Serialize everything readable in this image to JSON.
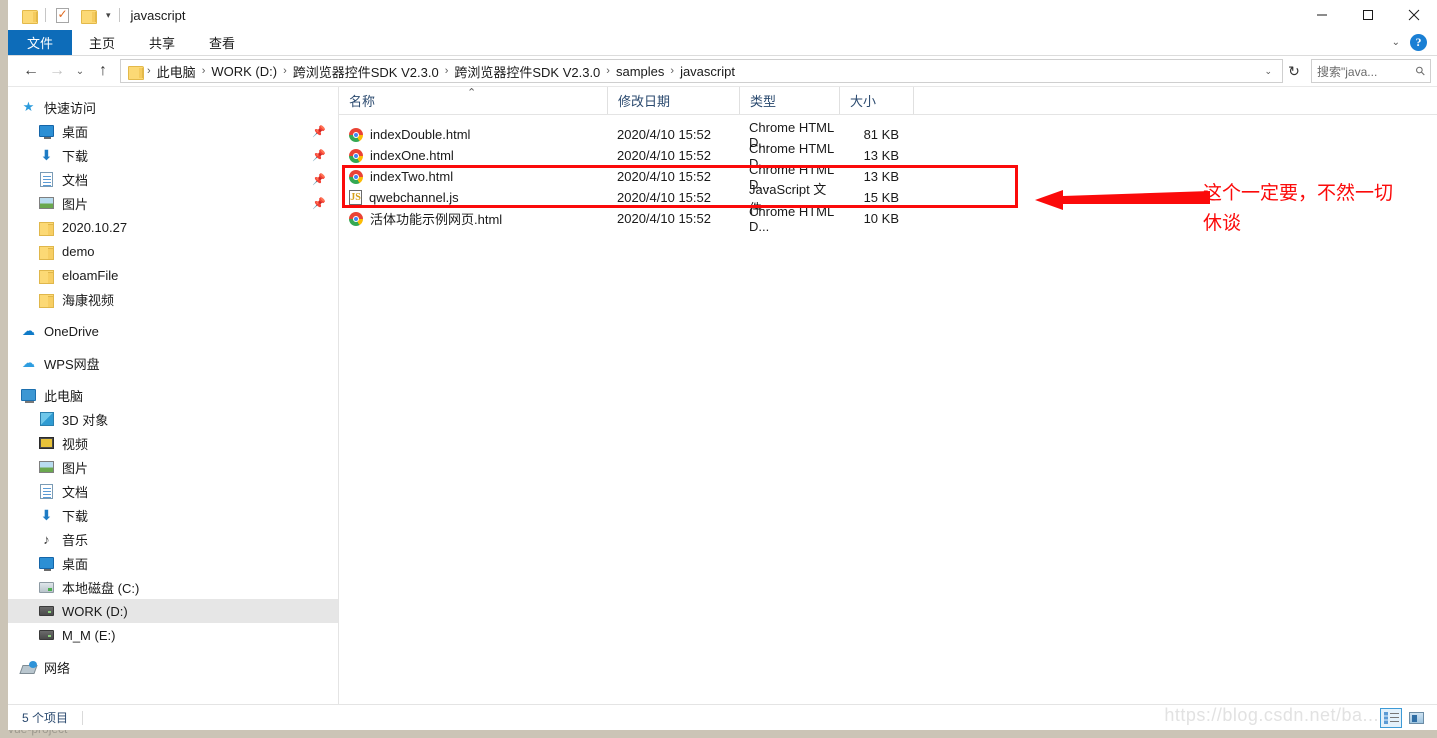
{
  "window": {
    "title": "javascript",
    "controls": {
      "minimize": "minimize-icon",
      "maximize": "maximize-icon",
      "close": "close-icon"
    },
    "quick_access_toolbar": [
      "folder-icon",
      "properties-icon",
      "new-folder-icon",
      "customize-caret-icon"
    ]
  },
  "ribbon": {
    "tabs": [
      {
        "label": "文件",
        "active": true
      },
      {
        "label": "主页",
        "active": false
      },
      {
        "label": "共享",
        "active": false
      },
      {
        "label": "查看",
        "active": false
      }
    ],
    "collapse_caret": "⌄",
    "help_label": "?"
  },
  "nav": {
    "back_icon": "←",
    "forward_icon": "→",
    "recent_icon": "⌄",
    "up_icon": "↑",
    "breadcrumbs": [
      "此电脑",
      "WORK (D:)",
      "跨浏览器控件SDK V2.3.0",
      "跨浏览器控件SDK V2.3.0",
      "samples",
      "javascript"
    ],
    "breadcrumb_separator": "›",
    "dropdown_caret": "⌄",
    "refresh_icon": "↻"
  },
  "search": {
    "placeholder": "搜索\"java...",
    "icon": "search-icon"
  },
  "sidebar": {
    "items": [
      {
        "label": "快速访问",
        "icon": "star-pin-icon",
        "level": 0,
        "pinned": false,
        "selected": false
      },
      {
        "label": "桌面",
        "icon": "desktop-icon",
        "level": 1,
        "pinned": true,
        "selected": false
      },
      {
        "label": "下载",
        "icon": "download-icon",
        "level": 1,
        "pinned": true,
        "selected": false
      },
      {
        "label": "文档",
        "icon": "documents-icon",
        "level": 1,
        "pinned": true,
        "selected": false
      },
      {
        "label": "图片",
        "icon": "pictures-icon",
        "level": 1,
        "pinned": true,
        "selected": false
      },
      {
        "label": "2020.10.27",
        "icon": "folder-icon",
        "level": 1,
        "pinned": false,
        "selected": false
      },
      {
        "label": "demo",
        "icon": "folder-icon",
        "level": 1,
        "pinned": false,
        "selected": false
      },
      {
        "label": "eloamFile",
        "icon": "folder-icon",
        "level": 1,
        "pinned": false,
        "selected": false
      },
      {
        "label": "海康视频",
        "icon": "folder-icon",
        "level": 1,
        "pinned": false,
        "selected": false
      },
      {
        "label": "OneDrive",
        "icon": "onedrive-icon",
        "level": 0,
        "pinned": false,
        "selected": false
      },
      {
        "label": "WPS网盘",
        "icon": "wps-cloud-icon",
        "level": 0,
        "pinned": false,
        "selected": false
      },
      {
        "label": "此电脑",
        "icon": "this-pc-icon",
        "level": 0,
        "pinned": false,
        "selected": false
      },
      {
        "label": "3D 对象",
        "icon": "3d-objects-icon",
        "level": 1,
        "pinned": false,
        "selected": false
      },
      {
        "label": "视频",
        "icon": "videos-icon",
        "level": 1,
        "pinned": false,
        "selected": false
      },
      {
        "label": "图片",
        "icon": "pictures-icon",
        "level": 1,
        "pinned": false,
        "selected": false
      },
      {
        "label": "文档",
        "icon": "documents-icon",
        "level": 1,
        "pinned": false,
        "selected": false
      },
      {
        "label": "下载",
        "icon": "download-icon",
        "level": 1,
        "pinned": false,
        "selected": false
      },
      {
        "label": "音乐",
        "icon": "music-icon",
        "level": 1,
        "pinned": false,
        "selected": false
      },
      {
        "label": "桌面",
        "icon": "desktop-icon",
        "level": 1,
        "pinned": false,
        "selected": false
      },
      {
        "label": "本地磁盘 (C:)",
        "icon": "local-disk-icon",
        "level": 1,
        "pinned": false,
        "selected": false
      },
      {
        "label": "WORK (D:)",
        "icon": "drive-icon",
        "level": 1,
        "pinned": false,
        "selected": true
      },
      {
        "label": "M_M (E:)",
        "icon": "drive-icon",
        "level": 1,
        "pinned": false,
        "selected": false
      },
      {
        "label": "网络",
        "icon": "network-icon",
        "level": 0,
        "pinned": false,
        "selected": false
      }
    ]
  },
  "file_list": {
    "columns": [
      "名称",
      "修改日期",
      "类型",
      "大小"
    ],
    "sort_column": "名称",
    "sort_caret": "⌃",
    "rows": [
      {
        "name": "indexDouble.html",
        "date": "2020/4/10 15:52",
        "type": "Chrome HTML D...",
        "size": "81 KB",
        "icon": "chrome-icon"
      },
      {
        "name": "indexOne.html",
        "date": "2020/4/10 15:52",
        "type": "Chrome HTML D...",
        "size": "13 KB",
        "icon": "chrome-icon"
      },
      {
        "name": "indexTwo.html",
        "date": "2020/4/10 15:52",
        "type": "Chrome HTML D...",
        "size": "13 KB",
        "icon": "chrome-icon"
      },
      {
        "name": "qwebchannel.js",
        "date": "2020/4/10 15:52",
        "type": "JavaScript 文件",
        "size": "15 KB",
        "icon": "javascript-file-icon"
      },
      {
        "name": "活体功能示例网页.html",
        "date": "2020/4/10 15:52",
        "type": "Chrome HTML D...",
        "size": "10 KB",
        "icon": "chrome-icon"
      }
    ]
  },
  "annotation": {
    "text": "这个一定要，不然一切\n休谈",
    "color": "#fb0a0a",
    "highlight_rows": [
      "indexTwo.html",
      "qwebchannel.js"
    ]
  },
  "statusbar": {
    "item_count_text": "5 个项目",
    "view_details_icon": "details-view-icon",
    "view_tiles_icon": "large-icons-view-icon"
  },
  "watermark": {
    "text": "https://blog.csdn.net/ba..."
  },
  "taskbar": {
    "text": "vue-project"
  },
  "colors": {
    "accent": "#0d6cb9",
    "annotation_red": "#fb0a0a",
    "selection_gray": "#e6e6e6",
    "header_text": "#2b4a6f"
  }
}
